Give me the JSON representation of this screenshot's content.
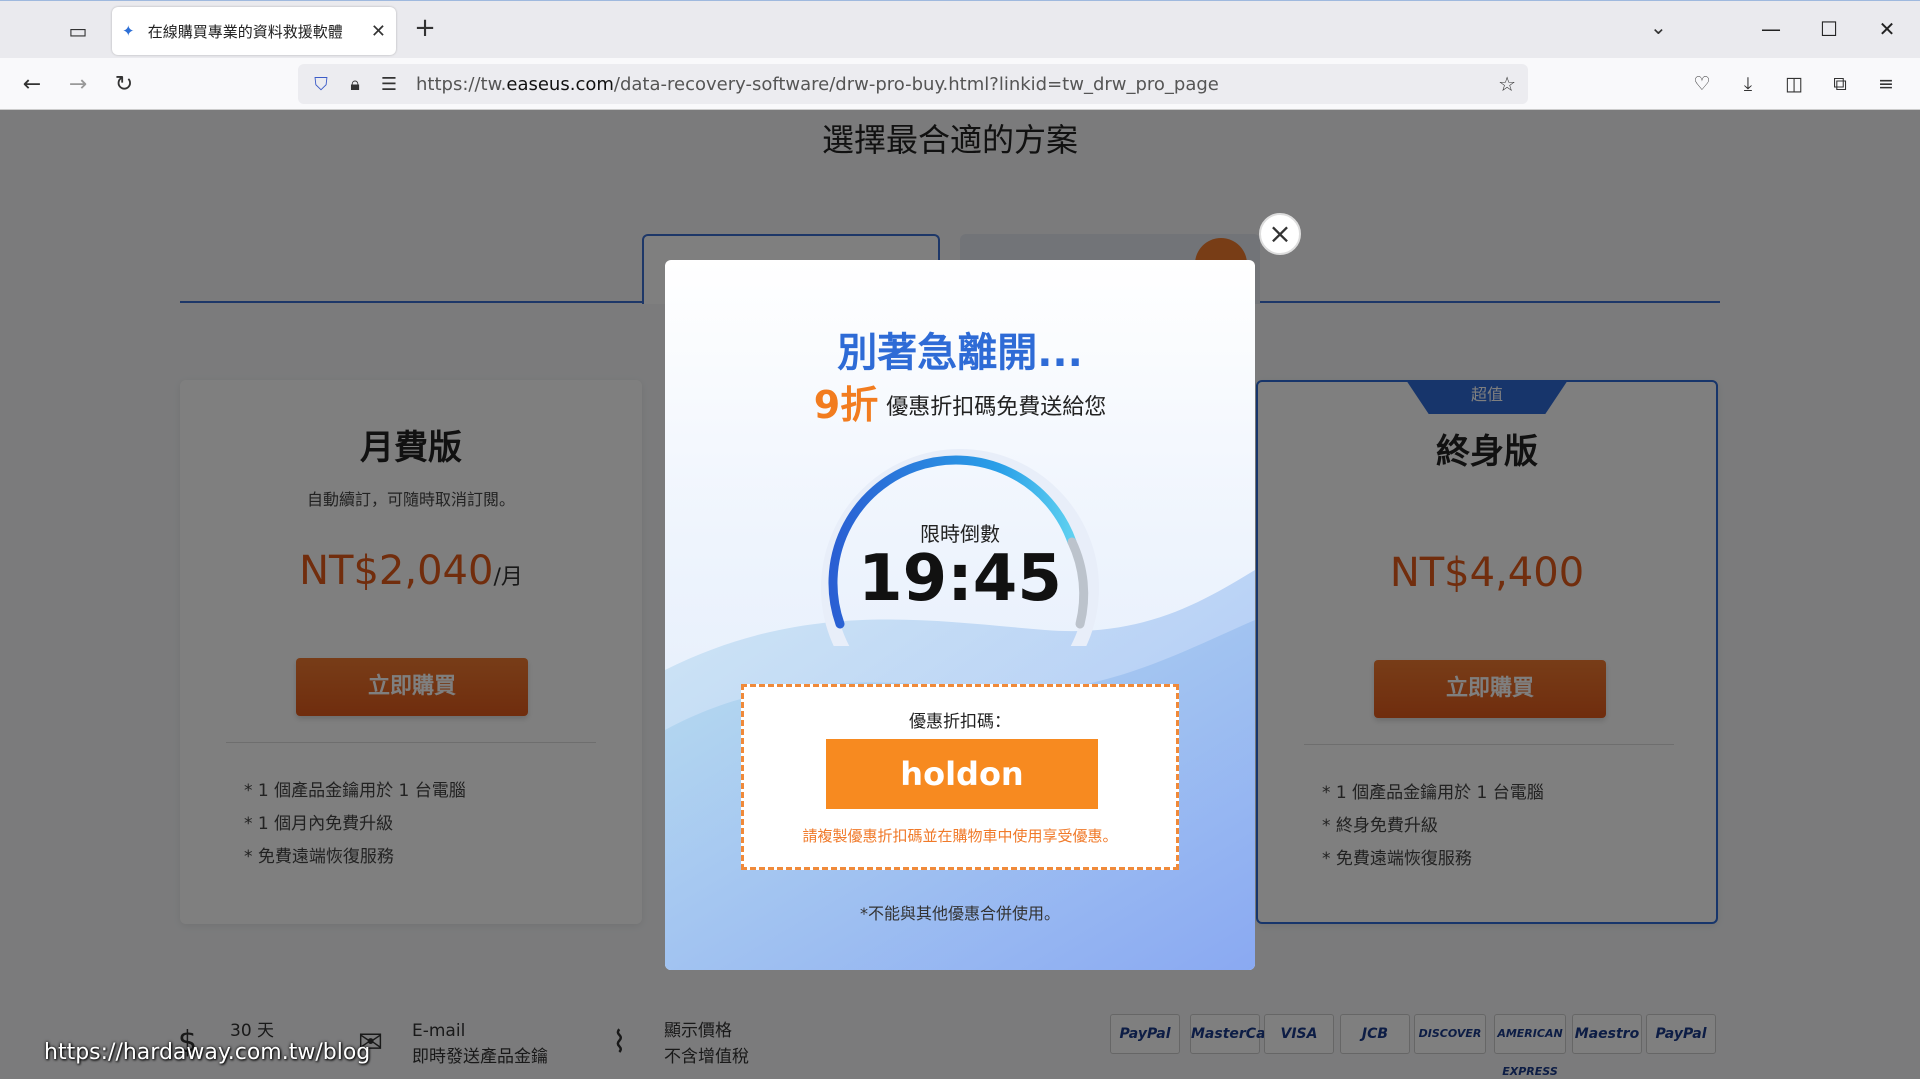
{
  "browser": {
    "tab_title": "在線購買專業的資料救援軟體",
    "url_prefix": "https://tw.",
    "url_domain": "easeus.com",
    "url_path": "/data-recovery-software/drw-pro-buy.html?linkid=tw_drw_pro_page"
  },
  "page": {
    "title": "選擇最合適的方案",
    "plans": [
      {
        "name": "月費版",
        "desc": "自動續訂，可隨時取消訂閱。",
        "price": "NT$2,040",
        "price_unit": "/月",
        "buy": "立即購買",
        "features": [
          "* 1 個產品金鑰用於 1 台電腦",
          "* 1 個月內免費升級",
          "* 免費遠端恢復服務"
        ]
      },
      {
        "ribbon": "超值",
        "name": "終身版",
        "price": "NT$4,400",
        "buy": "立即購買",
        "features": [
          "* 1 個產品金鑰用於 1 台電腦",
          "* 終身免費升級",
          "* 免費遠端恢復服務"
        ]
      }
    ],
    "footer": [
      {
        "line1": "30 天",
        "line2": ""
      },
      {
        "line1": "E-mail",
        "line2": "即時發送產品金鑰"
      },
      {
        "line1": "顯示價格",
        "line2": "不含增值稅"
      }
    ],
    "payments": [
      "PayPal",
      "MasterCard",
      "VISA",
      "JCB",
      "DISCOVER",
      "AMERICAN EXPRESS",
      "Maestro",
      "PayPal"
    ]
  },
  "modal": {
    "headline": "別著急離開...",
    "discount": "9折",
    "subtitle": "優惠折扣碼免費送給您",
    "timer_label": "限時倒數",
    "timer": "19:45",
    "coupon_label": "優惠折扣碼：",
    "coupon_code": "holdon",
    "coupon_hint": "請複製優惠折扣碼並在購物車中使用享受優惠。",
    "note": "*不能與其他優惠合併使用。"
  },
  "watermark": "https://hardaway.com.tw/blog",
  "colors": {
    "accent_blue": "#2e6bd6",
    "accent_orange": "#f78a20",
    "price_red": "#e25a1a"
  }
}
